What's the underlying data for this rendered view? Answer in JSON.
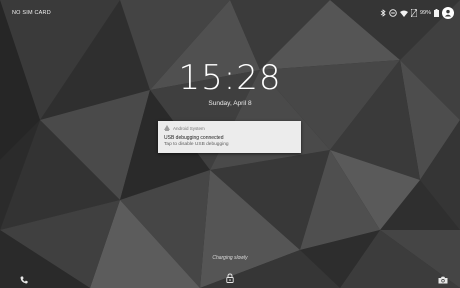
{
  "status_bar": {
    "carrier": "NO SIM CARD",
    "battery_percent": "99%",
    "icons": [
      "bluetooth-icon",
      "do-not-disturb-icon",
      "wifi-icon",
      "no-sim-icon",
      "battery-icon",
      "user-avatar-icon"
    ]
  },
  "lockscreen": {
    "time": "15:28",
    "date": "Sunday, April 8",
    "charging_status": "Charging slowly"
  },
  "notification": {
    "app_name": "Android System",
    "app_icon": "android-icon",
    "title": "USB debugging connected",
    "text": "Tap to disable USB debugging"
  },
  "bottom_actions": {
    "left": "phone-icon",
    "center": "lock-icon",
    "right": "camera-icon"
  },
  "colors": {
    "wallpaper_base": "#2e2e2e",
    "notification_bg": "#ececec",
    "text_primary": "#ffffff"
  }
}
